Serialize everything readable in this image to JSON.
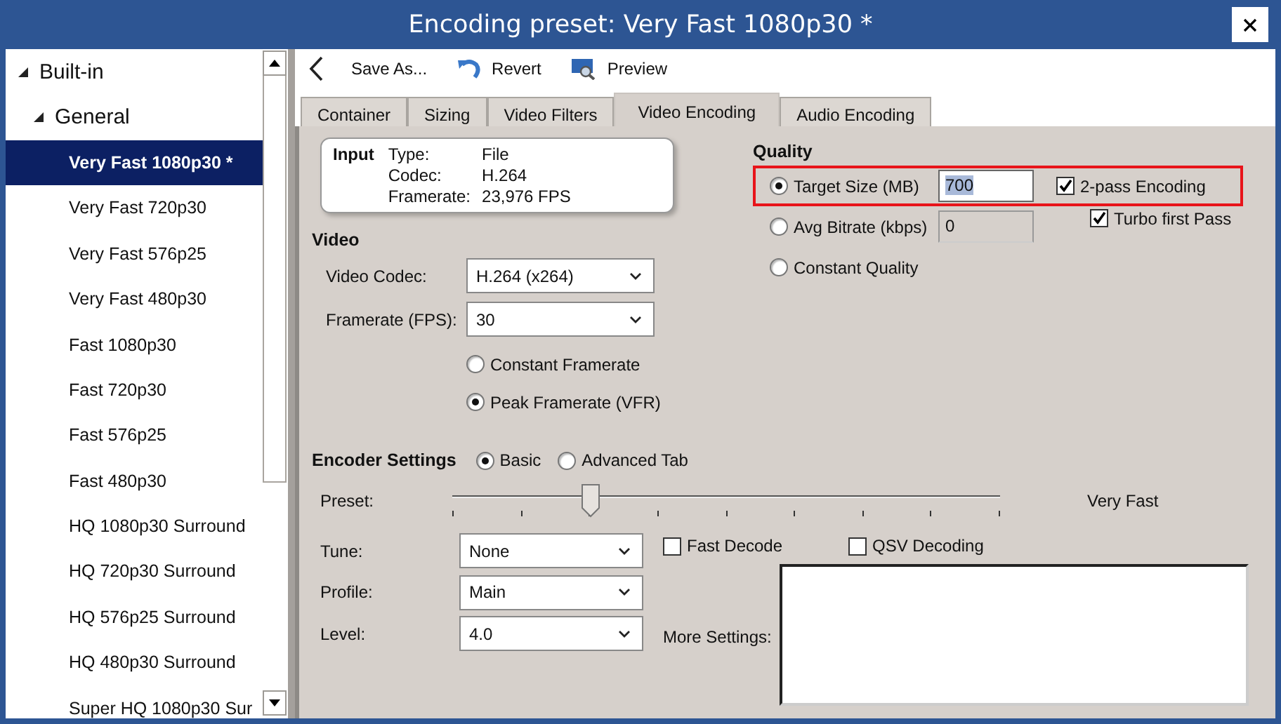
{
  "window": {
    "title": "Encoding preset: Very Fast 1080p30 *"
  },
  "sidebar": {
    "items": [
      {
        "label": "Built-in",
        "expanded": true,
        "children": [
          {
            "label": "General",
            "expanded": true,
            "children": [
              {
                "label": "Very Fast 1080p30 *",
                "selected": true
              },
              {
                "label": "Very Fast 720p30",
                "selected": false
              },
              {
                "label": "Very Fast 576p25",
                "selected": false
              },
              {
                "label": "Very Fast 480p30",
                "selected": false
              },
              {
                "label": "Fast 1080p30",
                "selected": false
              },
              {
                "label": "Fast 720p30",
                "selected": false
              },
              {
                "label": "Fast 576p25",
                "selected": false
              },
              {
                "label": "Fast 480p30",
                "selected": false
              },
              {
                "label": "HQ 1080p30 Surround",
                "selected": false
              },
              {
                "label": "HQ 720p30 Surround",
                "selected": false
              },
              {
                "label": "HQ 576p25 Surround",
                "selected": false
              },
              {
                "label": "HQ 480p30 Surround",
                "selected": false
              },
              {
                "label": "Super HQ 1080p30 Sur",
                "selected": false
              }
            ]
          }
        ]
      }
    ]
  },
  "toolbar": {
    "buttons": [
      {
        "kind": "back"
      },
      {
        "kind": "text",
        "label": "Save As..."
      },
      {
        "kind": "revert",
        "label": "Revert"
      },
      {
        "kind": "preview",
        "label": "Preview"
      }
    ]
  },
  "tabs": [
    {
      "label": "Container",
      "selected": false
    },
    {
      "label": "Sizing",
      "selected": false
    },
    {
      "label": "Video Filters",
      "selected": false
    },
    {
      "label": "Video Encoding",
      "selected": true
    },
    {
      "label": "Audio Encoding",
      "selected": false
    }
  ],
  "input_info": {
    "title": "Input",
    "rows": [
      {
        "label": "Type:",
        "value": "File"
      },
      {
        "label": "Codec:",
        "value": "H.264"
      },
      {
        "label": "Framerate:",
        "value": "23,976 FPS"
      }
    ]
  },
  "video": {
    "title": "Video",
    "fields": [
      {
        "label": "Video Codec:",
        "value": "H.264 (x264)"
      },
      {
        "label": "Framerate (FPS):",
        "value": "30"
      }
    ],
    "framerate_modes": [
      {
        "label": "Constant Framerate",
        "selected": false
      },
      {
        "label": "Peak Framerate (VFR)",
        "selected": true
      }
    ]
  },
  "quality": {
    "title": "Quality",
    "modes": [
      {
        "label": "Target Size (MB)",
        "selected": true,
        "value": "700",
        "highlighted": true
      },
      {
        "label": "Avg Bitrate (kbps)",
        "selected": false,
        "value": "0",
        "highlighted": false
      },
      {
        "label": "Constant Quality",
        "selected": false,
        "highlighted": false
      }
    ],
    "options": [
      {
        "label": "2-pass Encoding",
        "checked": true
      },
      {
        "label": "Turbo first Pass",
        "checked": true
      }
    ]
  },
  "encoder": {
    "title": "Encoder Settings",
    "modes": [
      {
        "label": "Basic",
        "selected": true
      },
      {
        "label": "Advanced Tab",
        "selected": false
      }
    ],
    "preset": {
      "label": "Preset:",
      "level": 0.25,
      "value": "Very Fast"
    },
    "fields": [
      {
        "label": "Tune:",
        "value": "None"
      },
      {
        "label": "Profile:",
        "value": "Main"
      },
      {
        "label": "Level:",
        "value": "4.0"
      }
    ],
    "options": [
      {
        "label": "Fast Decode",
        "checked": false
      },
      {
        "label": "QSV Decoding",
        "checked": false
      }
    ],
    "more_settings": {
      "label": "More Settings:"
    }
  }
}
